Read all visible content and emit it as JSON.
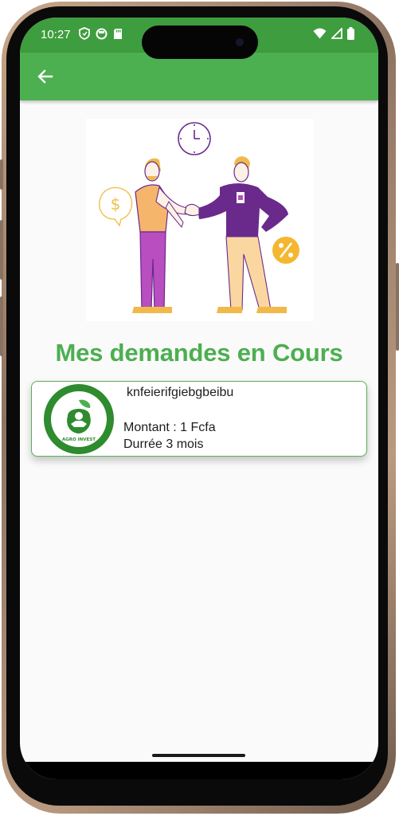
{
  "status_bar": {
    "time": "10:27",
    "left_icons": [
      "shield-icon",
      "circle-app-icon",
      "sd-card-icon"
    ],
    "right_icons": [
      "wifi-icon",
      "signal-icon",
      "battery-icon"
    ]
  },
  "app_bar": {
    "back_icon": "arrow-left-icon",
    "color": "#4caf50"
  },
  "main": {
    "title": "Mes demandes en Cours",
    "requests": [
      {
        "name": "knfeierifgiebgbeibu",
        "amount": "Montant : 1 Fcfa",
        "duration": "Durrée 3 mois",
        "logo_text": "AGRO INVEST"
      }
    ]
  },
  "colors": {
    "primary": "#4caf50",
    "status_bar": "#3e9d3e",
    "logo_ring": "#2e8b2e"
  }
}
